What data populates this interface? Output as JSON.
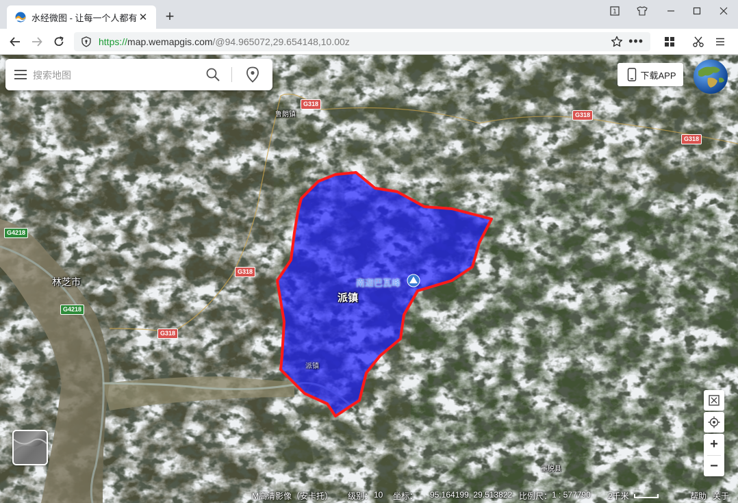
{
  "browser": {
    "tab_title": "水经微图 - 让每一个人都有自",
    "url_scheme": "https://",
    "url_host": "map.wemapgis.com",
    "url_rest": "/@94.965072,29.654148,10.00z"
  },
  "search": {
    "placeholder": "搜索地图"
  },
  "toolbar": {
    "download_app": "下载APP"
  },
  "map": {
    "place_labels": {
      "nyingchi": "林芝市",
      "luolang": "鲁朗镇",
      "pai_town": "派镇",
      "pai_town_small": "派镇",
      "namcha_barwa": "南迦巴瓦峰",
      "medog": "墨脱县"
    },
    "road_labels": {
      "g318_a": "G318",
      "g318_b": "G318",
      "g318_c": "G318",
      "g318_d": "G318",
      "g318_e": "G318",
      "g4218_a": "G4218",
      "g4218_b": "G4218"
    },
    "colors": {
      "boundary_stroke": "#ff1a1a",
      "boundary_fill": "#1a1aff"
    }
  },
  "status": {
    "imagery": "M高清影像（安卡托）",
    "level_label": "级别：",
    "level_value": "10",
    "coord_label": "坐标：",
    "coord_value": "95.164199, 29.513822",
    "scale_label": "比例尺：",
    "scale_value": "1 : 577790",
    "distance": "2千米",
    "help": "帮助",
    "about": "关于"
  }
}
